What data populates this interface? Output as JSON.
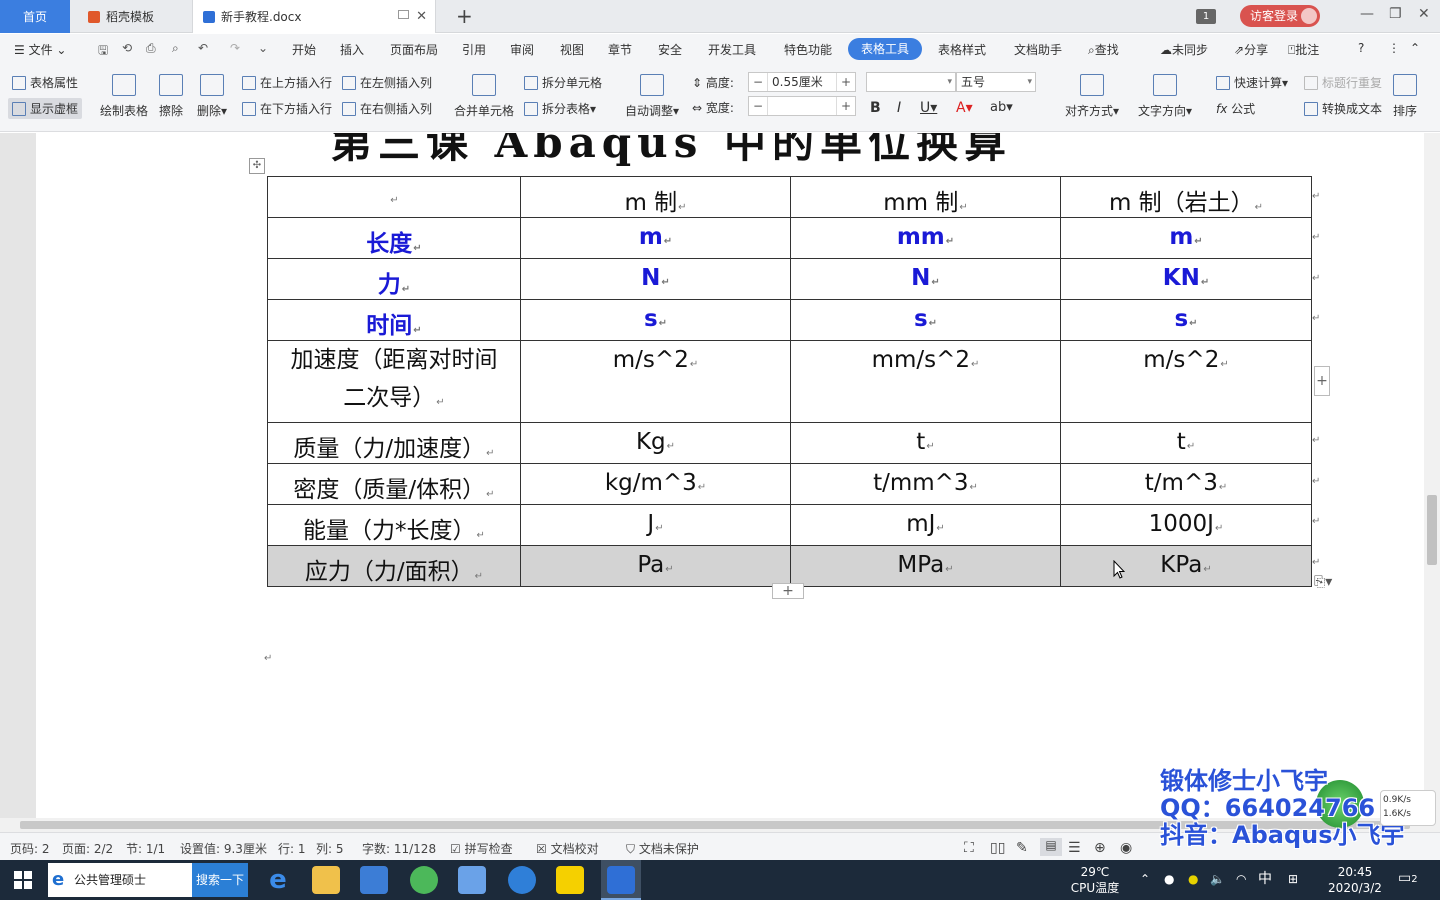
{
  "tabs": {
    "home": "首页",
    "template": "稻壳模板",
    "doc": "新手教程.docx"
  },
  "titlebar": {
    "badge": "1",
    "login": "访客登录"
  },
  "menu": {
    "file": "文件",
    "items": [
      "开始",
      "插入",
      "页面布局",
      "引用",
      "审阅",
      "视图",
      "章节",
      "安全",
      "开发工具",
      "特色功能"
    ],
    "active": "表格工具",
    "after": [
      "表格样式",
      "文档助手"
    ],
    "search": "查找",
    "sync": "未同步",
    "share": "分享",
    "comment": "批注"
  },
  "ribbon": {
    "table_props": "表格属性",
    "show_gridlines": "显示虚框",
    "draw_table": "绘制表格",
    "erase": "擦除",
    "delete": "删除",
    "insert_above": "在上方插入行",
    "insert_below": "在下方插入行",
    "insert_left": "在左侧插入列",
    "insert_right": "在右侧插入列",
    "merge_cells": "合并单元格",
    "split_cell": "拆分单元格",
    "split_table": "拆分表格",
    "auto_fit": "自动调整",
    "height_label": "高度:",
    "height_value": "0.55厘米",
    "width_label": "宽度:",
    "width_value": "",
    "font_name": "",
    "font_size": "五号",
    "align": "对齐方式",
    "text_dir": "文字方向",
    "quick_calc": "快速计算",
    "repeat_header": "标题行重复",
    "formula": "公式",
    "to_text": "转换成文本",
    "sort": "排序"
  },
  "document": {
    "heading": "第三课 Abaqus 中的单位换算",
    "table": {
      "header": [
        "",
        "m 制",
        "mm 制",
        "m 制（岩土）"
      ],
      "rows": [
        [
          "长度",
          "m",
          "mm",
          "m"
        ],
        [
          "力",
          "N",
          "N",
          "KN"
        ],
        [
          "时间",
          "s",
          "s",
          "s"
        ],
        [
          "加速度（距离对时间二次导）",
          "m/s^2",
          "mm/s^2",
          "m/s^2"
        ],
        [
          "质量（力/加速度）",
          "Kg",
          "t",
          "t"
        ],
        [
          "密度（质量/体积）",
          "kg/m^3",
          "t/mm^3",
          "t/m^3"
        ],
        [
          "能量（力*长度）",
          "J",
          "mJ",
          "1000J"
        ],
        [
          "应力（力/面积）",
          "Pa",
          "MPa",
          "KPa"
        ]
      ]
    }
  },
  "statusbar": {
    "page_num": "页码: 2",
    "page": "页面: 2/2",
    "section": "节: 1/1",
    "setting": "设置值: 9.3厘米",
    "row": "行: 1",
    "col": "列: 5",
    "words": "字数: 11/128",
    "spell": "拼写检查",
    "proof": "文档校对",
    "protect": "文档未保护"
  },
  "overlay": {
    "line1": "锻体修士小飞宇",
    "line2": "QQ：664024766",
    "line3": "抖音：Abaqus小飞宇"
  },
  "netspeed": {
    "up": "0.9K/s",
    "down": "1.6K/s"
  },
  "taskbar": {
    "search_text": "公共管理硕士",
    "search_btn": "搜索一下",
    "temp": "29℃",
    "temp_label": "CPU温度",
    "ime": "中",
    "time": "20:45",
    "date": "2020/3/2",
    "notif": "2"
  }
}
